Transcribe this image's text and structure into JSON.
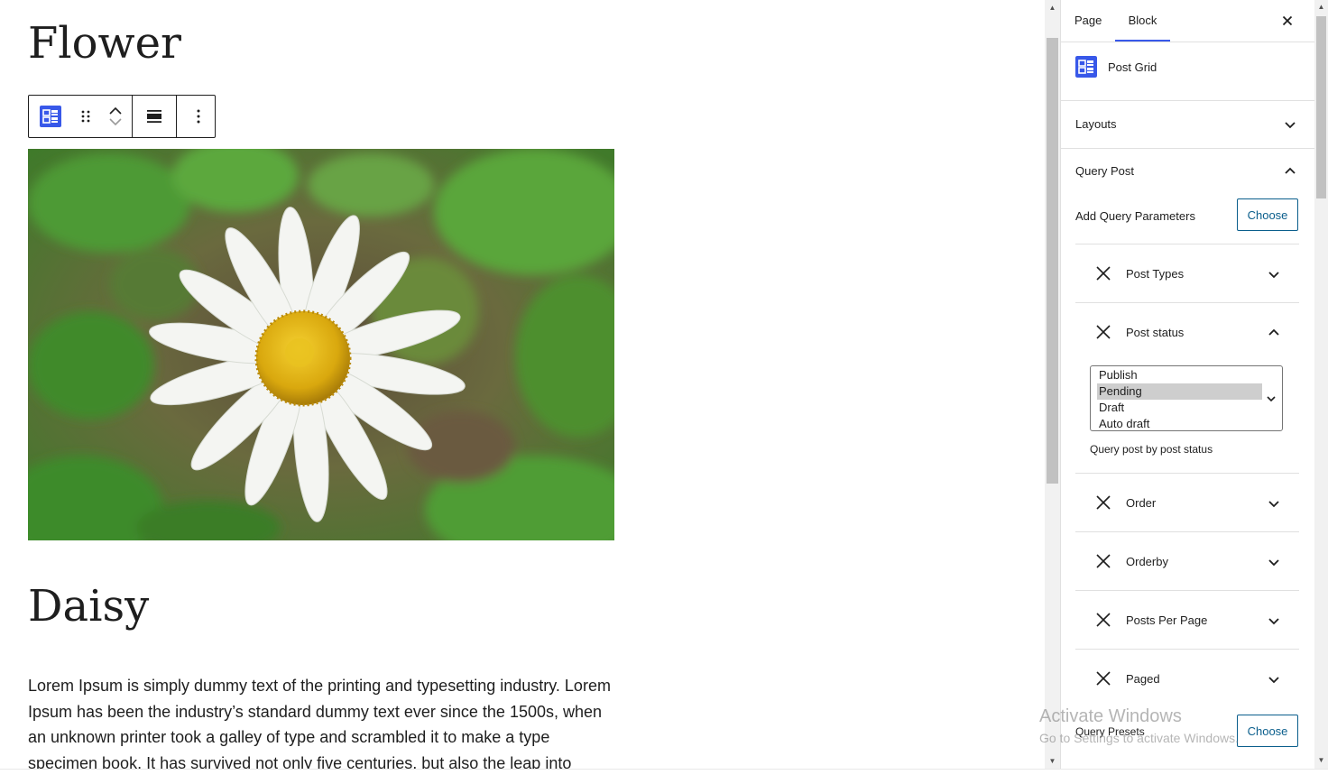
{
  "editor": {
    "post_title": "Flower",
    "heading": "Daisy",
    "paragraph": "Lorem Ipsum is simply dummy text of the printing and typesetting industry. Lorem Ipsum has been the industry’s standard dummy text ever since the 1500s, when an unknown printer took a galley of type and scrambled it to make a type specimen book. It has survived not only five centuries, but also the leap into"
  },
  "toolbar": {
    "icons": [
      "post-grid-icon",
      "drag-handle-icon",
      "move-up-icon",
      "move-down-icon",
      "align-icon",
      "more-options-icon"
    ]
  },
  "sidebar": {
    "tabs": [
      {
        "label": "Page",
        "active": false
      },
      {
        "label": "Block",
        "active": true
      }
    ],
    "block_name": "Post Grid",
    "panels": {
      "layouts": "Layouts",
      "query_post": "Query Post"
    },
    "add_query_parameters_label": "Add Query Parameters",
    "choose_label": "Choose",
    "query_items": {
      "post_types": "Post Types",
      "post_status": "Post status",
      "order": "Order",
      "orderby": "Orderby",
      "posts_per_page": "Posts Per Page",
      "paged": "Paged"
    },
    "post_status_options": [
      "Publish",
      "Pending",
      "Draft",
      "Auto draft"
    ],
    "post_status_selected": "Pending",
    "post_status_help": "Query post by post status",
    "query_presets_label": "Query Presets"
  },
  "watermark": {
    "line1": "Activate Windows",
    "line2": "Go to Settings to activate Windows."
  },
  "colors": {
    "accent": "#3858e9",
    "button_border": "#0a5e8c",
    "selected_option": "#cecece"
  }
}
